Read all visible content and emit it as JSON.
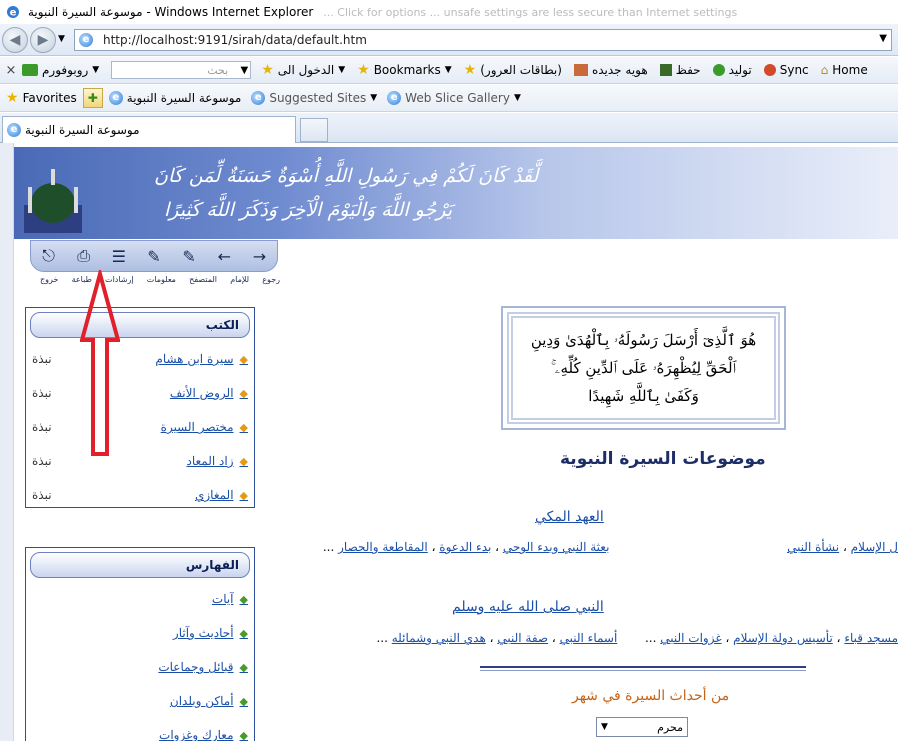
{
  "window": {
    "title": "موسوعة السيرة النبوية - Windows Internet Explorer",
    "faded_text": "... Click for options ... unsafe settings are less secure than Internet settings"
  },
  "addressbar": {
    "url": "http://localhost:9191/sirah/data/default.htm"
  },
  "commandbar": {
    "close_label": "×",
    "toolbar_name": "روبوفورم",
    "search_placeholder": "بحث",
    "login_label": "الدخول الى",
    "bookmarks_label": "Bookmarks",
    "cards_label": "(بطاقات العرور)",
    "new_identity_label": "هويه جديده",
    "save_label": "حفظ",
    "generate_label": "توليد",
    "sync_label": "Sync",
    "home_label": "Home"
  },
  "favoritesbar": {
    "favorites_label": "Favorites",
    "site_label": "موسوعة السيرة النبوية",
    "suggested_label": "Suggested Sites",
    "webslice_label": "Web Slice Gallery"
  },
  "tab": {
    "title": "موسوعة السيرة النبوية"
  },
  "banner": {
    "verse_line1": "لَّقَدْ كَانَ لَكُمْ فِي رَسُولِ اللَّهِ أُسْوَةٌ حَسَنَةٌ لِّمَن كَانَ",
    "verse_line2": "يَرْجُو اللَّهَ وَالْيَوْمَ الْآخِرَ وَذَكَرَ اللَّهَ كَثِيرًا"
  },
  "toolstrip": {
    "labels": [
      "خروج",
      "طباعة",
      "إرشادات",
      "معلومات",
      "المتصفح",
      "للإمام",
      "رجوع"
    ]
  },
  "books_panel": {
    "title": "الكتب",
    "items": [
      {
        "label": "سيرة ابن هشام",
        "note": "نبذة"
      },
      {
        "label": "الروض الأنف",
        "note": "نبذة"
      },
      {
        "label": "مختصر السيرة",
        "note": "نبذة"
      },
      {
        "label": "زاد المعاد",
        "note": "نبذة"
      },
      {
        "label": "المغازي",
        "note": "نبذة"
      }
    ]
  },
  "index_panel": {
    "title": "الفهارس",
    "items": [
      {
        "label": "آيات"
      },
      {
        "label": "أحاديث وآثار"
      },
      {
        "label": "قبائل وجماعات"
      },
      {
        "label": "أماكن وبلدان"
      },
      {
        "label": "معارك وغزوات"
      }
    ]
  },
  "verse_box": {
    "line1": "هُوَ ٱلَّذِىٓ أَرْسَلَ رَسُولَهُۥ بِٱلْهُدَىٰ وَدِينِ",
    "line2": "ٱلْحَقِّ لِيُظْهِرَهُۥ عَلَى ٱلدِّينِ كُلِّهِۦ ۚ",
    "line3": "وَكَفَىٰ بِٱللَّهِ شَهِيدًا"
  },
  "topics": {
    "title": "موضوعات السيرة النبوية",
    "meccan": {
      "title": "العهد المكي",
      "links": [
        "ل الإسلام",
        "نشأة النبي",
        "بعثة النبي وبدء الوحي",
        "بدء الدعوة",
        "المقاطعة والحصار"
      ],
      "sep": "،",
      "more": "..."
    },
    "prophet": {
      "title": "النبي صلى الله عليه وسلم",
      "links": [
        "مسجد قباء",
        "تأسيس دولة الإسلام",
        "غزوات النبي",
        "أسماء النبي",
        "صفة النبي",
        "هدي النبي وشمائله"
      ],
      "sep": "،",
      "more": "..."
    },
    "month_events": "من أحداث السيرة في شهر",
    "month_selected": "محرم"
  }
}
